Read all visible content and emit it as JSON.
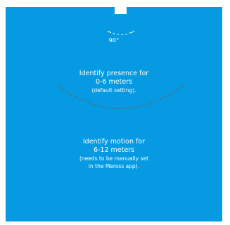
{
  "diagram": {
    "colors": {
      "background": "#059ae1",
      "text": "#ffffff",
      "arc": "#5a6f7c"
    },
    "angle_label": "90°",
    "zones": [
      {
        "heading_line1": "Identify presence for",
        "heading_line2": "0-6 meters",
        "note_line1": "(default setting).",
        "note_line2": ""
      },
      {
        "heading_line1": "Identify motion for",
        "heading_line2": "6-12 meters",
        "note_line1": "(needs to be manually set",
        "note_line2": "in the Meross app)."
      }
    ]
  }
}
